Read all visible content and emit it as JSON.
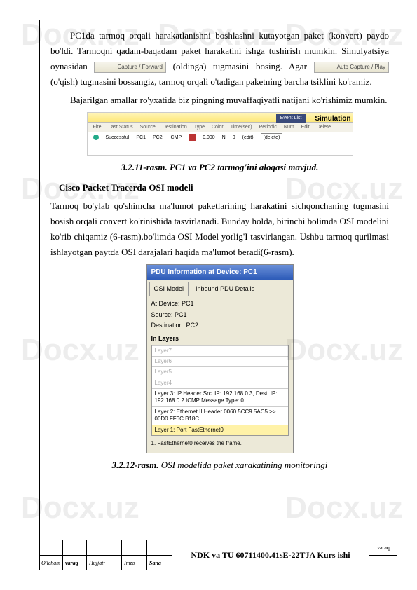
{
  "watermark": "Docx.uz",
  "para1_a": "PC1da tarmoq orqali harakatlanishni boshlashni kutayotgan paket (konvert) paydo bo'ldi. Tarmoqni qadam-baqadam paket harakatini ishga tushirish mumkin. Simulyatsiya oynasidan ",
  "btn1": "Capture / Forward",
  "para1_b": " (oldinga) tugmasini bosing. Agar ",
  "btn2": "Auto Capture / Play",
  "para1_c": " (o'qish) tugmasini bossangiz, tarmoq orqali o'tadigan paketning barcha tsiklini ko'ramiz.",
  "para2": "Bajarilgan amallar ro'yxatida biz pingning muvaffaqiyatli natijani ko'rishimiz mumkin.",
  "sim": {
    "eventlist": "Event List",
    "simulation": "Simulation",
    "hdr": [
      "Fire",
      "Last Status",
      "Source",
      "Destination",
      "Type",
      "Color",
      "Time(sec)",
      "Periodic",
      "Num",
      "Edit",
      "Delete"
    ],
    "row": [
      "",
      "Successful",
      "PC1",
      "PC2",
      "ICMP",
      "",
      "0.000",
      "N",
      "0",
      "(edit)",
      "(delete)"
    ]
  },
  "caption1_a": "3.2.11-rasm.",
  "caption1_b": " PC1 va PC2 tarmog'ini aloqasi mavjud.",
  "subheading": "Cisco Packet Tracerda OSI modeli",
  "para3": "Tarmoq bo'ylab qo'shimcha ma'lumot paketlarining harakatini sichqonchaning tugmasini bosish orqali convert ko'rinishida tasvirlanadi.  Bunday holda, birinchi bolimda OSI modelini ko'rib chiqamiz (6-rasm).bo'limda OSI Model yorlig'I tasvirlangan. Ushbu tarmoq qurilmasi ishlayotgan paytda OSI darajalari haqida ma'lumot beradi(6-rasm).",
  "pdu": {
    "title": "PDU Information at Device: PC1",
    "tab1": "OSI Model",
    "tab2": "Inbound PDU Details",
    "at": "At Device: PC1",
    "src": "Source: PC1",
    "dst": "Destination: PC2",
    "in": "In Layers",
    "l7": "Layer7",
    "l6": "Layer6",
    "l5": "Layer5",
    "l4": "Layer4",
    "l3": "Layer 3: IP Header Src. IP: 192.168.0.3, Dest. IP: 192.168.0.2 ICMP Message Type: 0",
    "l2": "Layer 2: Ethernet II Header 0060.5CC9.5AC5 >> 00D0.FF6C.B18C",
    "l1": "Layer 1: Port FastEthernet0",
    "foot": "1. FastEthernet0 receives the frame."
  },
  "caption2_a": "3.2.12-rasm.",
  "caption2_b": " OSI modelida paket xarakatining monitoringi",
  "titleblock": {
    "c1": "O'lcham",
    "c2": "varaq",
    "c3": "Hujjat:",
    "c4": "Imzo",
    "c5": "Sana",
    "main": "NDK va TU  60711400.41sE-22TJA Kurs ishi",
    "right": "varaq"
  }
}
